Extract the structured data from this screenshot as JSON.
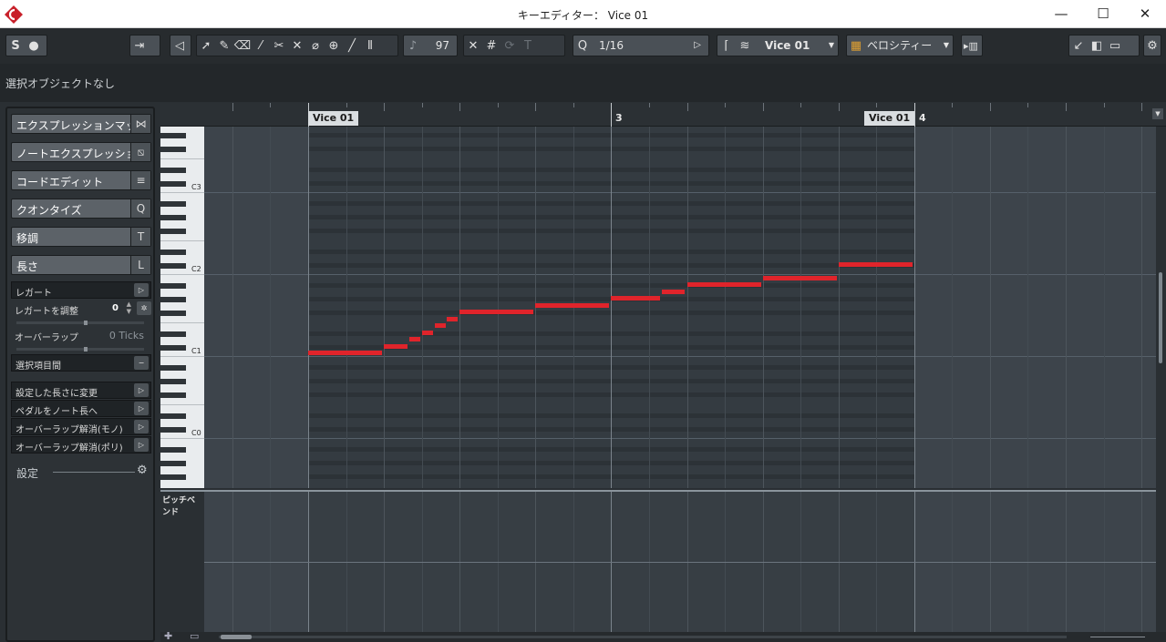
{
  "window": {
    "title": "キーエディター： Vice 01",
    "controls": [
      "—",
      "☐",
      "✕"
    ]
  },
  "toolbar": {
    "solo_label": "S",
    "record_label": "●",
    "velocity_value": "97",
    "quantize_label": "Q",
    "quantize_value": "1/16",
    "part_name": "Vice 01",
    "color_mode": "ベロシティー"
  },
  "infoline": {
    "text": "選択オブジェクトなし"
  },
  "inspector": {
    "sections": [
      {
        "label": "エクスプレッションマップ",
        "icon": "⋈"
      },
      {
        "label": "ノートエクスプレッション",
        "icon": "⧅"
      },
      {
        "label": "コードエディット",
        "icon": "≡"
      },
      {
        "label": "クオンタイズ",
        "icon": "Q"
      },
      {
        "label": "移調",
        "icon": "T"
      },
      {
        "label": "長さ",
        "icon": "L"
      }
    ],
    "legato_label": "レガート",
    "legato_adjust_label": "レガートを調整",
    "legato_adjust_value": "0",
    "overlap_label": "オーバーラップ",
    "overlap_value": "0 Ticks",
    "selected_range_label": "選択項目間",
    "actions": [
      "設定した長さに変更",
      "ペダルをノート長へ",
      "オーバーラップ解消(モノ)",
      "オーバーラップ解消(ポリ)"
    ],
    "settings_label": "設定"
  },
  "ruler": {
    "bar3": "3",
    "bar4": "4",
    "event_start_label": "Vice 01",
    "event_end_label": "Vice 01"
  },
  "keyboard": {
    "labels": [
      "C3",
      "C2",
      "C1",
      "C0"
    ]
  },
  "controller": {
    "lane_label": "ピッチベンド"
  },
  "notes": [
    {
      "pitch": "C1",
      "start_beat": 0,
      "length_beats": 1.0
    },
    {
      "pitch": "C#1",
      "start_beat": 1.0,
      "length_beats": 0.33
    },
    {
      "pitch": "D1",
      "start_beat": 1.33,
      "length_beats": 0.17
    },
    {
      "pitch": "D#1",
      "start_beat": 1.5,
      "length_beats": 0.17
    },
    {
      "pitch": "E1",
      "start_beat": 1.67,
      "length_beats": 0.17
    },
    {
      "pitch": "F1",
      "start_beat": 1.83,
      "length_beats": 0.17
    },
    {
      "pitch": "F#1",
      "start_beat": 2.0,
      "length_beats": 1.0
    },
    {
      "pitch": "G1",
      "start_beat": 3.0,
      "length_beats": 1.0
    },
    {
      "pitch": "G#1",
      "start_beat": 4.0,
      "length_beats": 0.67
    },
    {
      "pitch": "A1",
      "start_beat": 4.67,
      "length_beats": 0.33
    },
    {
      "pitch": "A#1",
      "start_beat": 5.0,
      "length_beats": 1.0
    },
    {
      "pitch": "B1",
      "start_beat": 6.0,
      "length_beats": 1.0
    },
    {
      "pitch": "C#2",
      "start_beat": 7.0,
      "length_beats": 1.0
    }
  ]
}
